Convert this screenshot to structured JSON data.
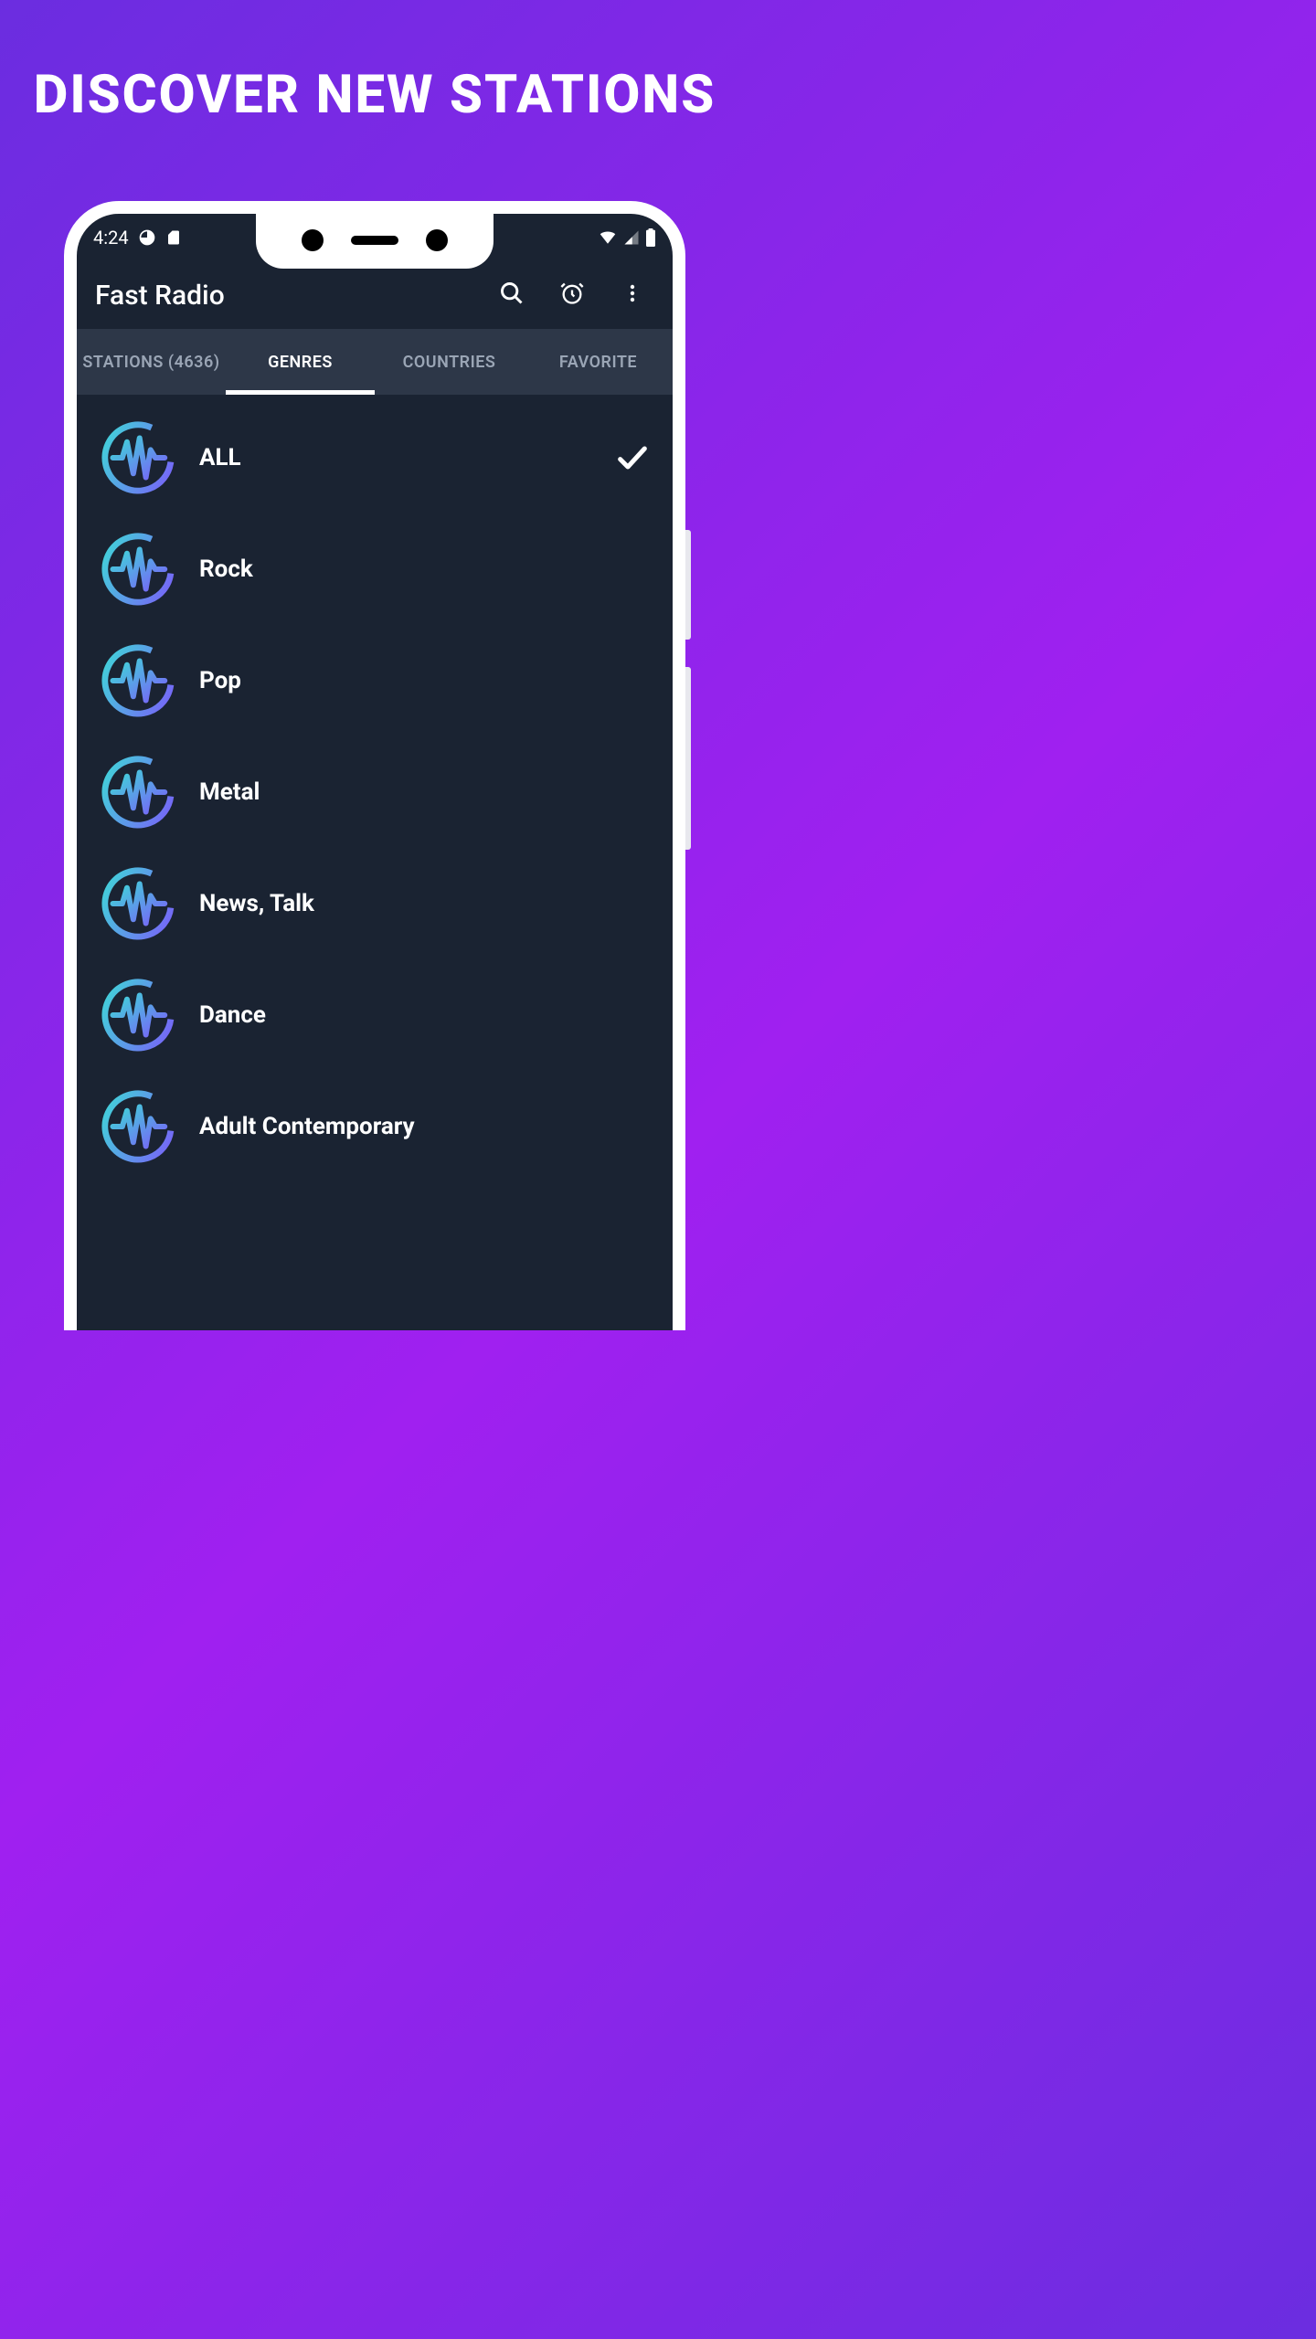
{
  "promo": {
    "headline": "DISCOVER NEW STATIONS"
  },
  "status": {
    "time": "4:24"
  },
  "app": {
    "title": "Fast Radio"
  },
  "tabs": [
    {
      "label": "STATIONS (4636)",
      "active": false
    },
    {
      "label": "GENRES",
      "active": true
    },
    {
      "label": "COUNTRIES",
      "active": false
    },
    {
      "label": "FAVORITE",
      "active": false
    }
  ],
  "genres": [
    {
      "label": "ALL",
      "selected": true
    },
    {
      "label": "Rock",
      "selected": false
    },
    {
      "label": "Pop",
      "selected": false
    },
    {
      "label": "Metal",
      "selected": false
    },
    {
      "label": "News, Talk",
      "selected": false
    },
    {
      "label": "Dance",
      "selected": false
    },
    {
      "label": "Adult Contemporary",
      "selected": false
    }
  ],
  "colors": {
    "gradient_start": "#6B2DE0",
    "gradient_end": "#A020F0",
    "screen_bg": "#1a2332",
    "tab_bg": "#2d3748",
    "icon_cyan": "#3DDAD7",
    "icon_purple": "#7B5CFA"
  }
}
